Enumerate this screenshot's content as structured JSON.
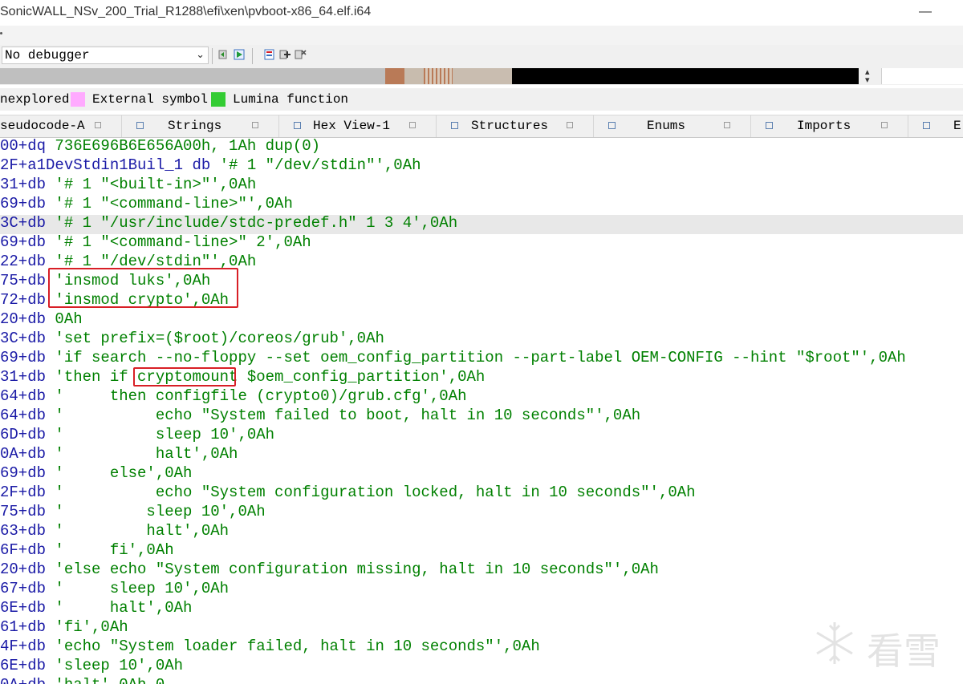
{
  "window": {
    "title": "SonicWALL_NSv_200_Trial_R1288\\efi\\xen\\pvboot-x86_64.elf.i64",
    "minimize_glyph": "—"
  },
  "toolbar": {
    "debugger_select": {
      "value": "No debugger"
    }
  },
  "legend": {
    "items": [
      {
        "label": "nexplored",
        "color": ""
      },
      {
        "label": "External symbol",
        "color": "#ffaaff"
      },
      {
        "label": "Lumina function",
        "color": "#33cc33"
      }
    ]
  },
  "tabs": [
    {
      "label": "seudocode-A"
    },
    {
      "label": "Strings"
    },
    {
      "label": "Hex View-1"
    },
    {
      "label": "Structures"
    },
    {
      "label": "Enums"
    },
    {
      "label": "Imports"
    },
    {
      "label": "E"
    }
  ],
  "code_lines": [
    {
      "addr": "00+dq",
      "body": " 736E696B6E656A00h, 1Ah dup(0)"
    },
    {
      "addr": "2F+a1DevStdin1Buil_1 db",
      "body": " '# 1 \"/dev/stdin\"',0Ah"
    },
    {
      "addr": "31+db",
      "body": " '# 1 \"<built-in>\"',0Ah"
    },
    {
      "addr": "69+db",
      "body": " '# 1 \"<command-line>\"',0Ah"
    },
    {
      "addr": "3C+db",
      "body": " '# 1 \"/usr/include/stdc-predef.h\" 1 3 4',0Ah"
    },
    {
      "addr": "69+db",
      "body": " '# 1 \"<command-line>\" 2',0Ah"
    },
    {
      "addr": "22+db",
      "body": " '# 1 \"/dev/stdin\"',0Ah"
    },
    {
      "addr": "75+db",
      "body": " 'insmod luks',0Ah"
    },
    {
      "addr": "72+db",
      "body": " 'insmod crypto',0Ah"
    },
    {
      "addr": "20+db",
      "body": " 0Ah"
    },
    {
      "addr": "3C+db",
      "body": " 'set prefix=($root)/coreos/grub',0Ah"
    },
    {
      "addr": "69+db",
      "body": " 'if search --no-floppy --set oem_config_partition --part-label OEM-CONFIG --hint \"$root\"',0Ah"
    },
    {
      "addr": "31+db",
      "body": " 'then if cryptomount $oem_config_partition',0Ah"
    },
    {
      "addr": "64+db",
      "body": " '     then configfile (crypto0)/grub.cfg',0Ah"
    },
    {
      "addr": "64+db",
      "body": " '          echo \"System failed to boot, halt in 10 seconds\"',0Ah"
    },
    {
      "addr": "6D+db",
      "body": " '          sleep 10',0Ah"
    },
    {
      "addr": "0A+db",
      "body": " '          halt',0Ah"
    },
    {
      "addr": "69+db",
      "body": " '     else',0Ah"
    },
    {
      "addr": "2F+db",
      "body": " '          echo \"System configuration locked, halt in 10 seconds\"',0Ah"
    },
    {
      "addr": "75+db",
      "body": " '         sleep 10',0Ah"
    },
    {
      "addr": "63+db",
      "body": " '         halt',0Ah"
    },
    {
      "addr": "6F+db",
      "body": " '     fi',0Ah"
    },
    {
      "addr": "20+db",
      "body": " 'else echo \"System configuration missing, halt in 10 seconds\"',0Ah"
    },
    {
      "addr": "67+db",
      "body": " '     sleep 10',0Ah"
    },
    {
      "addr": "6E+db",
      "body": " '     halt',0Ah"
    },
    {
      "addr": "61+db",
      "body": " 'fi',0Ah"
    },
    {
      "addr": "4F+db",
      "body": " 'echo \"System loader failed, halt in 10 seconds\"',0Ah"
    },
    {
      "addr": "6E+db",
      "body": " 'sleep 10',0Ah"
    },
    {
      "addr": "0A+db",
      "body": " 'halt',0Ah,0"
    }
  ],
  "watermark": {
    "text": "看雪"
  },
  "colors": {
    "address": "#1a1aa6",
    "string": "#008000",
    "highlight_box": "#d81f26",
    "current_line": "#e8e8e8"
  }
}
